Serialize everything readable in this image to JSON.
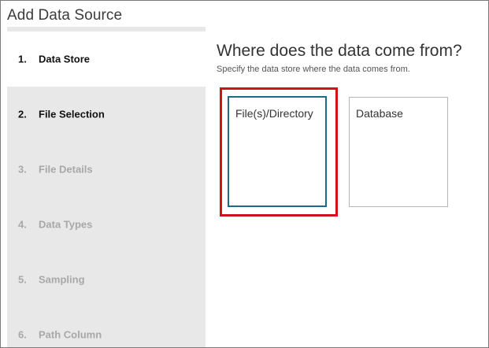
{
  "dialog": {
    "title": "Add Data Source"
  },
  "steps": [
    {
      "number": "1.",
      "label": "Data Store",
      "state": "active"
    },
    {
      "number": "2.",
      "label": "File Selection",
      "state": "done"
    },
    {
      "number": "3.",
      "label": "File Details",
      "state": "todo"
    },
    {
      "number": "4.",
      "label": "Data Types",
      "state": "todo"
    },
    {
      "number": "5.",
      "label": "Sampling",
      "state": "todo"
    },
    {
      "number": "6.",
      "label": "Path Column",
      "state": "todo"
    }
  ],
  "main": {
    "heading": "Where does the data come from?",
    "subheading": "Specify the data store where the data comes from.",
    "options": [
      {
        "label": "File(s)/Directory",
        "selected": true
      },
      {
        "label": "Database",
        "selected": false
      }
    ]
  },
  "colors": {
    "selection_border": "#1d6b86",
    "highlight_frame": "#d0111b",
    "sidebar_bg": "#e8e8e8"
  }
}
